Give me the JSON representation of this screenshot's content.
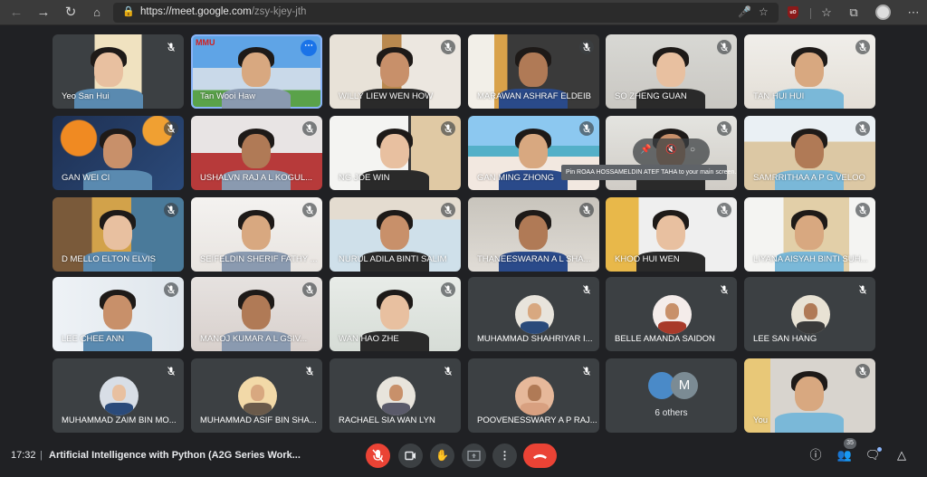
{
  "browser": {
    "url_host": "https://meet.google.com",
    "url_path": "/zsy-kjey-jth",
    "icons": [
      "back-icon",
      "forward-icon",
      "refresh-icon",
      "home-icon",
      "lock-icon",
      "microphone-icon",
      "add-favorite-icon",
      "ublock-icon",
      "favorites-icon",
      "collections-icon",
      "profile-icon",
      "more-icon"
    ],
    "ublock_label": "uO"
  },
  "tooltip": "Pin ROAA HOSSAMELDIN ATEF TAHA to your main screen.",
  "participants": [
    {
      "name": "Yeo San Hui",
      "muted": true
    },
    {
      "name": "Tan Wooi Haw",
      "muted": false,
      "active": true,
      "logo": "MMU"
    },
    {
      "name": "WILLY LIEW WEN HOW",
      "muted": true
    },
    {
      "name": "MARAWAN ASHRAF ELDEIB",
      "muted": true
    },
    {
      "name": "SO ZHENG GUAN",
      "muted": true
    },
    {
      "name": "TAN HUI HUI",
      "muted": true
    },
    {
      "name": "GAN WEI CI",
      "muted": true
    },
    {
      "name": "USHALVN RAJ A L KOGUL...",
      "muted": true
    },
    {
      "name": "NG JOE WIN",
      "muted": true
    },
    {
      "name": "GAN MING ZHONG",
      "muted": true
    },
    {
      "name": "ROAA HOSSAMELDIN ATEF TAHA",
      "muted": true,
      "hovered": true
    },
    {
      "name": "SAMRRITHAA A P G VELOO",
      "muted": true
    },
    {
      "name": "D MELLO ELTON ELVIS",
      "muted": true
    },
    {
      "name": "SEIFELDIN SHERIF FATHY ...",
      "muted": true
    },
    {
      "name": "NURUL ADILA BINTI SALIM",
      "muted": true
    },
    {
      "name": "THANEESWARAN A L SHA...",
      "muted": true
    },
    {
      "name": "KHOO HUI WEN",
      "muted": true
    },
    {
      "name": "LIYANA AISYAH BINTI SUH...",
      "muted": true
    },
    {
      "name": "LEE CHEE ANN",
      "muted": true
    },
    {
      "name": "MANOJ KUMAR A L GSIV...",
      "muted": true
    },
    {
      "name": "WAN HAO ZHE",
      "muted": true
    },
    {
      "name": "MUHAMMAD SHAHRIYAR I...",
      "muted": true,
      "avatar": true
    },
    {
      "name": "BELLE AMANDA SAIDON",
      "muted": true,
      "avatar": true
    },
    {
      "name": "LEE SAN HANG",
      "muted": true,
      "avatar": true
    },
    {
      "name": "MUHAMMAD ZAIM BIN MO...",
      "muted": true,
      "avatar": true
    },
    {
      "name": "MUHAMMAD ASIF BIN SHA...",
      "muted": true,
      "avatar": true
    },
    {
      "name": "RACHAEL SIA WAN LYN",
      "muted": true,
      "avatar": true
    },
    {
      "name": "POOVENESSWARY A P RAJ...",
      "muted": true,
      "avatar": true
    },
    {
      "name": "6 others",
      "others": true,
      "initial": "M"
    },
    {
      "name": "You",
      "muted": true
    }
  ],
  "bottom_bar": {
    "time": "17:32",
    "separator": "|",
    "meeting_title": "Artificial Intelligence with Python (A2G Series Work...",
    "controls": [
      "mic-off",
      "camera",
      "raise-hand",
      "present-screen",
      "more-options",
      "leave-call"
    ],
    "people_count": "35",
    "right_controls": [
      "meeting-details",
      "people",
      "chat",
      "activities"
    ]
  },
  "colors": {
    "background": "#202124",
    "tile": "#3c4043",
    "danger": "#ea4335",
    "accent": "#8ab4f8",
    "more_button": "#1a73e8"
  }
}
